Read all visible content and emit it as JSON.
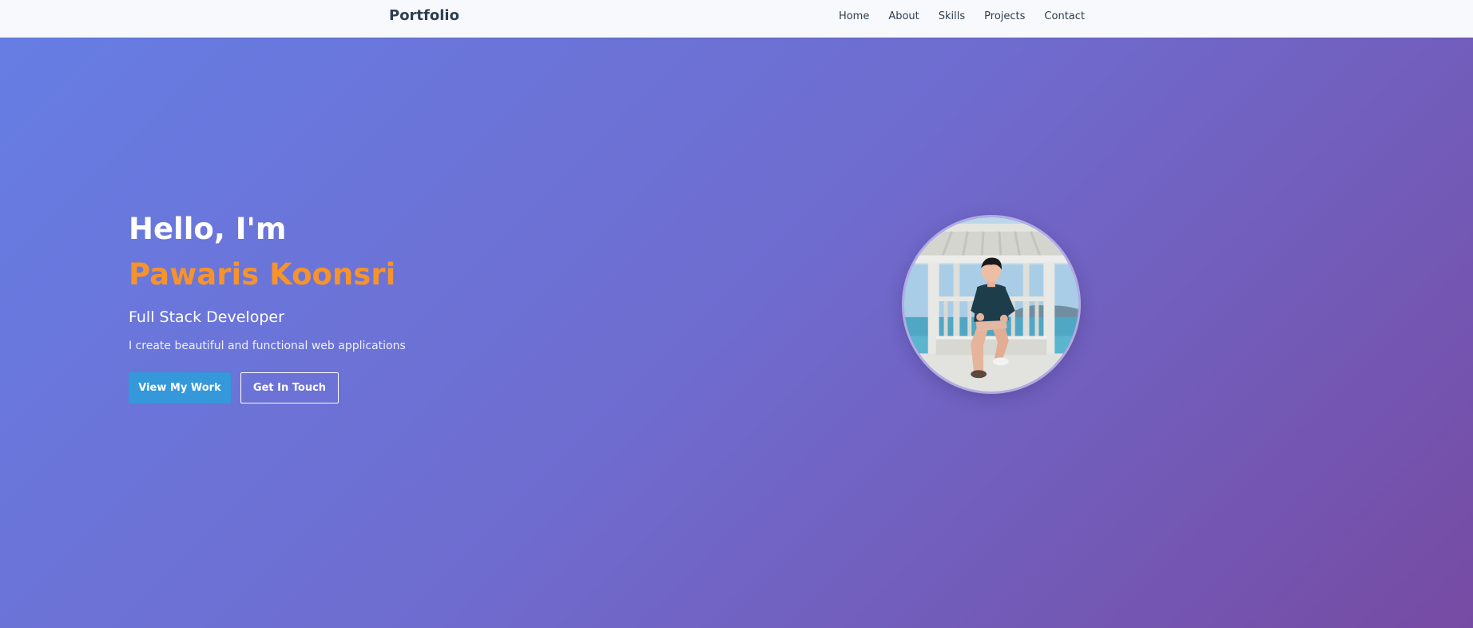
{
  "navbar": {
    "brand": "Portfolio",
    "links": [
      "Home",
      "About",
      "Skills",
      "Projects",
      "Contact"
    ]
  },
  "hero": {
    "greeting": "Hello, I'm ",
    "first_name": "Pawaris",
    "last_name": "Koonsri",
    "subtitle": "Full Stack Developer",
    "description": "I create beautiful and functional web applications",
    "primary_button": "View My Work",
    "secondary_button": "Get In Touch"
  },
  "colors": {
    "gradient_start": "#667ee4",
    "gradient_end": "#764ba3",
    "accent_name": "#f6932b",
    "primary_button": "#3498db",
    "navbar_text": "#2c3e50"
  }
}
